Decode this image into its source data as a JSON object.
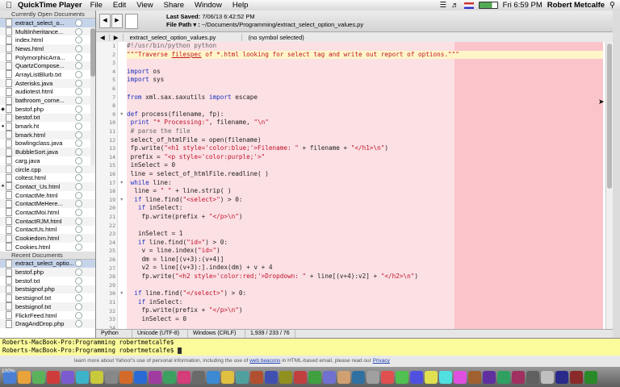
{
  "menubar": {
    "apple": "",
    "app_name": "QuickTime Player",
    "items": [
      "File",
      "Edit",
      "View",
      "Share",
      "Window",
      "Help"
    ],
    "clock": "Fri 6:59 PM",
    "user": "Robert Metcalfe"
  },
  "sidebar": {
    "open_header": "Currently Open Documents",
    "open_docs": [
      {
        "name": "extract_select_o...",
        "mark": "",
        "selected": true
      },
      {
        "name": "MultiInheritance...",
        "mark": ""
      },
      {
        "name": "index.html",
        "mark": ""
      },
      {
        "name": "News.html",
        "mark": ""
      },
      {
        "name": "PolymorphicArra...",
        "mark": ""
      },
      {
        "name": "QuartzCompose...",
        "mark": ""
      },
      {
        "name": "ArrayListBlurb.txt",
        "mark": ""
      },
      {
        "name": "Asterisks.java",
        "mark": ""
      },
      {
        "name": "audiotest.html",
        "mark": ""
      },
      {
        "name": "bathroom_corne...",
        "mark": ""
      },
      {
        "name": "bestof.php",
        "mark": "◆"
      },
      {
        "name": "bestof.txt",
        "mark": ""
      },
      {
        "name": "bmark.ht",
        "mark": "●"
      },
      {
        "name": "bmark.html",
        "mark": ""
      },
      {
        "name": "bowlingclass.java",
        "mark": ""
      },
      {
        "name": "BubbleSort.java",
        "mark": ""
      },
      {
        "name": "carg.java",
        "mark": ""
      },
      {
        "name": "circle.cpp",
        "mark": ""
      },
      {
        "name": "coltest.html",
        "mark": ""
      },
      {
        "name": "Contact_Us.html",
        "mark": "●"
      },
      {
        "name": "ContactMe.html",
        "mark": ""
      },
      {
        "name": "ContactMeHere...",
        "mark": ""
      },
      {
        "name": "ContactMoi.html",
        "mark": ""
      },
      {
        "name": "ContactRJM.html",
        "mark": ""
      },
      {
        "name": "ContactUs.html",
        "mark": ""
      },
      {
        "name": "Cookiedom.html",
        "mark": ""
      },
      {
        "name": "Cookies.html",
        "mark": ""
      }
    ],
    "recent_header": "Recent Documents",
    "recent_docs": [
      {
        "name": "extract_select_optio...",
        "mark": "",
        "selected": true
      },
      {
        "name": "bestof.php",
        "mark": ""
      },
      {
        "name": "bestof.txt",
        "mark": ""
      },
      {
        "name": "bestsignof.php",
        "mark": ""
      },
      {
        "name": "bestsignof.txt",
        "mark": ""
      },
      {
        "name": "bestsignof.txt",
        "mark": ""
      },
      {
        "name": "FlickrFeed.html",
        "mark": ""
      },
      {
        "name": "DragAndDrop.php",
        "mark": ""
      }
    ]
  },
  "toolbar": {
    "last_saved_label": "Last Saved:",
    "last_saved_value": "7/06/13 6:42:52 PM",
    "file_path_label": "File Path ▾ :",
    "file_path_value": "~/Documents/Programming/extract_select_option_values.py"
  },
  "pathbar": {
    "file": "extract_select_option_values.py",
    "symbol": "(no symbol selected)"
  },
  "code_lines": [
    [
      {
        "t": "#!/usr/bin/python python",
        "c": "com"
      }
    ],
    [
      {
        "t": "\"\"\"Traverse ",
        "c": "str"
      },
      {
        "t": "filespec",
        "c": "str ul"
      },
      {
        "t": " of *.html looking for select tag and write out report of options.\"\"\"",
        "c": "str"
      }
    ],
    [],
    [
      {
        "t": "import",
        "c": "kw"
      },
      {
        "t": " os"
      }
    ],
    [
      {
        "t": "import",
        "c": "kw"
      },
      {
        "t": " sys"
      }
    ],
    [],
    [
      {
        "t": "from",
        "c": "kw"
      },
      {
        "t": " xml.sax.saxutils "
      },
      {
        "t": "import",
        "c": "kw"
      },
      {
        "t": " escape"
      }
    ],
    [],
    [
      {
        "t": "def",
        "c": "kw"
      },
      {
        "t": " process(filename, fp):"
      }
    ],
    [
      {
        "t": " "
      },
      {
        "t": "print",
        "c": "kw"
      },
      {
        "t": " "
      },
      {
        "t": "\"* Processing:\"",
        "c": "str"
      },
      {
        "t": ", filename, "
      },
      {
        "t": "\"\\n\"",
        "c": "str"
      }
    ],
    [
      {
        "t": " # parse the file",
        "c": "com"
      }
    ],
    [
      {
        "t": " select_of_htmlFile = open(filename)"
      }
    ],
    [
      {
        "t": " fp.write("
      },
      {
        "t": "\"<h1 style='color:blue;'>Filename: \"",
        "c": "str"
      },
      {
        "t": " + filename + "
      },
      {
        "t": "\"</h1>\\n\"",
        "c": "str"
      },
      {
        "t": ")"
      }
    ],
    [
      {
        "t": " prefix = "
      },
      {
        "t": "\"<p style='color:purple;'>\"",
        "c": "str"
      }
    ],
    [
      {
        "t": " inSelect = 0"
      }
    ],
    [
      {
        "t": " line = select_of_htmlFile.readline( )"
      }
    ],
    [
      {
        "t": " "
      },
      {
        "t": "while",
        "c": "kw"
      },
      {
        "t": " line:"
      }
    ],
    [
      {
        "t": "  line = "
      },
      {
        "t": "\" \"",
        "c": "str"
      },
      {
        "t": " + line.strip( )"
      }
    ],
    [
      {
        "t": "  "
      },
      {
        "t": "if",
        "c": "kw"
      },
      {
        "t": " line.find("
      },
      {
        "t": "\"<select>\"",
        "c": "str"
      },
      {
        "t": ") > 0:"
      }
    ],
    [
      {
        "t": "   "
      },
      {
        "t": "if",
        "c": "kw"
      },
      {
        "t": " inSelect:"
      }
    ],
    [
      {
        "t": "    fp.write(prefix + "
      },
      {
        "t": "\"</p>\\n\"",
        "c": "str"
      },
      {
        "t": ")"
      }
    ],
    [],
    [
      {
        "t": "   inSelect = 1"
      }
    ],
    [
      {
        "t": "   "
      },
      {
        "t": "if",
        "c": "kw"
      },
      {
        "t": " line.find("
      },
      {
        "t": "\"id=\"",
        "c": "str"
      },
      {
        "t": ") > 0:"
      }
    ],
    [
      {
        "t": "    v = line.index("
      },
      {
        "t": "\"id=\"",
        "c": "str"
      },
      {
        "t": ")"
      }
    ],
    [
      {
        "t": "    dm = line[(v+3):(v+4)]"
      }
    ],
    [
      {
        "t": "    v2 = line[(v+3):].index(dm) + v + 4"
      }
    ],
    [
      {
        "t": "    fp.write("
      },
      {
        "t": "\"<h2 style='color:red;'>Dropdown: \"",
        "c": "str"
      },
      {
        "t": " + line[(v+4):v2] + "
      },
      {
        "t": "\"</h2>\\n\"",
        "c": "str"
      },
      {
        "t": ")"
      }
    ],
    [],
    [
      {
        "t": "  "
      },
      {
        "t": "if",
        "c": "kw"
      },
      {
        "t": " line.find("
      },
      {
        "t": "\"</select>\"",
        "c": "str"
      },
      {
        "t": ") > 0:"
      }
    ],
    [
      {
        "t": "   "
      },
      {
        "t": "if",
        "c": "kw"
      },
      {
        "t": " inSelect:"
      }
    ],
    [
      {
        "t": "    fp.write(prefix + "
      },
      {
        "t": "\"</p>\\n\"",
        "c": "str"
      },
      {
        "t": ")"
      }
    ],
    [
      {
        "t": "    inSelect = 0"
      }
    ],
    [],
    [
      {
        "t": "  "
      },
      {
        "t": "elif",
        "c": "kw"
      },
      {
        "t": " line.find("
      },
      {
        "t": "\"document.write\"",
        "c": "str"
      },
      {
        "t": ") > 0:"
      }
    ],
    [
      {
        "t": "   inSelect = inSelect"
      }
    ],
    [],
    [
      {
        "t": "  "
      },
      {
        "t": "elif",
        "c": "kw"
      },
      {
        "t": " line.find("
      },
      {
        "t": "\"<option>\"",
        "c": "str"
      },
      {
        "t": ") > 0 "
      },
      {
        "t": "and",
        "c": "kw"
      },
      {
        "t": " line.find("
      },
      {
        "t": "\"<\"",
        "c": "str"
      },
      {
        "t": ") > 0 "
      },
      {
        "t": "and",
        "c": "kw"
      },
      {
        "t": " inSelect:"
      }
    ]
  ],
  "status": {
    "language": "Python",
    "encoding": "Unicode (UTF-8)",
    "line_endings": "Windows (CRLF)",
    "stats": "1,939 / 233 / 76"
  },
  "terminal": {
    "lines": [
      "Roberts-MacBook-Pro:Programming robertmetcalfe$",
      "Roberts-MacBook-Pro:Programming robertmetcalfe$ "
    ]
  },
  "browser_strip": {
    "text": "learn more about Yahoo!'s use of personal information, including the use of ",
    "link1": "web beacons",
    "text2": " in HTML-based email, please read our ",
    "link2": "Privacy"
  },
  "zoom": "100%",
  "dock_colors": [
    "#4a7fd4",
    "#e8a33b",
    "#5bb25b",
    "#cf3b3b",
    "#7b5bd0",
    "#3cb3c9",
    "#c9c93c",
    "#888888",
    "#d46a2a",
    "#2a6ad4",
    "#a03ca0",
    "#3ca060",
    "#d43c7a",
    "#6a6a6a",
    "#3c8ad4",
    "#e0c040",
    "#50a0a0",
    "#b05030",
    "#4050b0",
    "#909020",
    "#c04040",
    "#40a040",
    "#7070d0",
    "#d0a070",
    "#3070a0",
    "#a0a0a0",
    "#e05050",
    "#50c050",
    "#5050e0",
    "#e0e050",
    "#50e0e0",
    "#e050e0",
    "#a06030",
    "#6030a0",
    "#30a060",
    "#a03060",
    "#606060",
    "#c0c0c0",
    "#2a2a8a",
    "#8a2a2a",
    "#2a8a2a"
  ]
}
